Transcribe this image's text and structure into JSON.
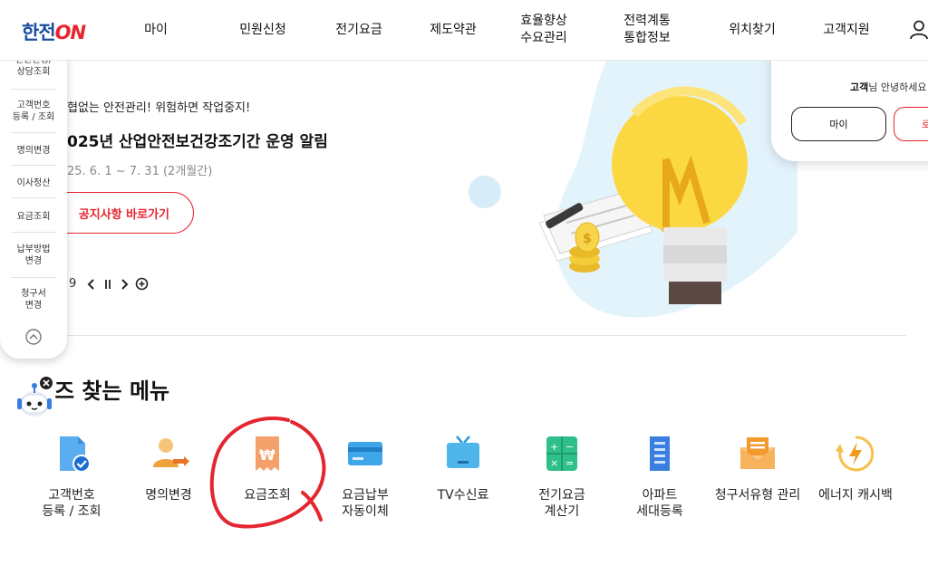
{
  "header": {
    "logo_left": "한전",
    "logo_right": "ON",
    "nav": [
      "마이",
      "민원신청",
      "전기요금",
      "제도약관",
      "효율향상\n수요관리",
      "전력계통\n통합정보",
      "위치찾기",
      "고객지원"
    ]
  },
  "quick_menu": {
    "items": [
      "민원신청/\n상담조회",
      "고객번호\n등록 / 조회",
      "명의변경",
      "이사정산",
      "요금조회",
      "납부방법\n변경",
      "청구서\n변경"
    ]
  },
  "banner": {
    "line1": "협없는 안전관리! 위험하면 작업중지!",
    "title": "025년 산업안전보건강조기간 운영 알림",
    "period": "25. 6. 1 ~ 7. 31 (2개월간)",
    "button": "공지사항 바로가기",
    "page_index": "9"
  },
  "login_card": {
    "greeting_name": "고객",
    "greeting_rest": "님 안녕하세요",
    "btn_my": "마이",
    "btn_login": "로"
  },
  "favorites": {
    "title": "즈 찾는 메뉴",
    "items": [
      {
        "label": "고객번호\n등록 / 조회",
        "icon": "customer-number-icon"
      },
      {
        "label": "명의변경",
        "icon": "name-change-icon"
      },
      {
        "label": "요금조회",
        "icon": "bill-inquiry-icon"
      },
      {
        "label": "요금납부\n자동이체",
        "icon": "card-payment-icon"
      },
      {
        "label": "TV수신료",
        "icon": "tv-icon"
      },
      {
        "label": "전기요금\n계산기",
        "icon": "calculator-icon"
      },
      {
        "label": "아파트\n세대등록",
        "icon": "apartment-icon"
      },
      {
        "label": "청구서유형 관리",
        "icon": "envelope-icon"
      },
      {
        "label": "에너지 캐시백",
        "icon": "energy-cashback-icon"
      }
    ]
  },
  "colors": {
    "brand_blue": "#1a4fa0",
    "brand_red": "#e8242f",
    "annotation_red": "#e3262f"
  }
}
